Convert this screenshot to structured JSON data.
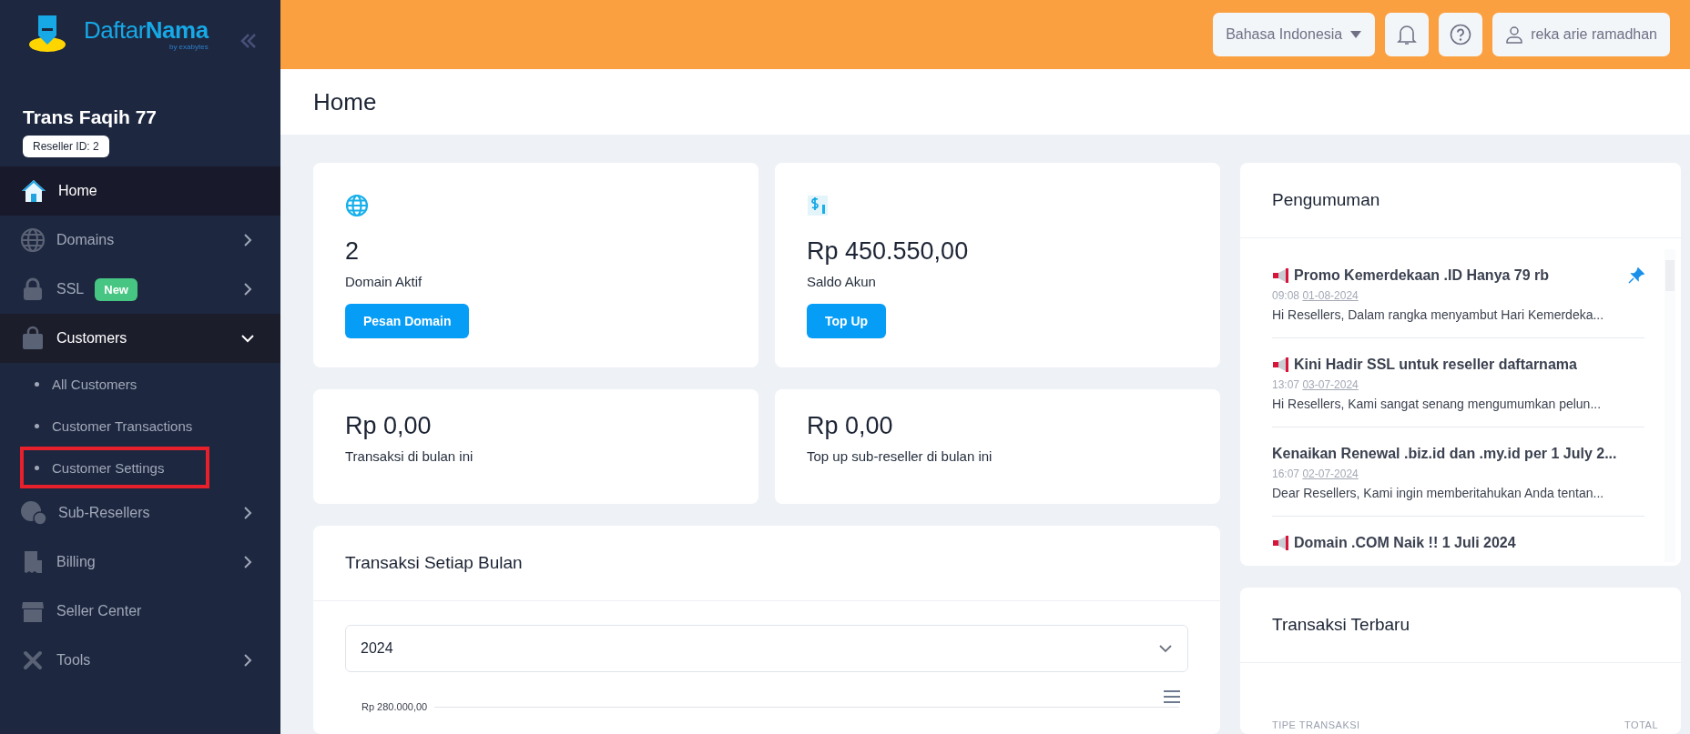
{
  "sidebar": {
    "logo": {
      "word_1": "Daftar",
      "word_2": "Nama",
      "byline": "by exabytes"
    },
    "account_name": "Trans Faqih 77",
    "reseller_id": "Reseller ID: 2",
    "items": [
      {
        "label": "Home",
        "selected": true
      },
      {
        "label": "Domains",
        "selected": false,
        "expanded": false
      },
      {
        "label": "SSL",
        "selected": false,
        "expanded": false,
        "badge": "New"
      },
      {
        "label": "Customers",
        "selected": false,
        "expanded": true,
        "children": [
          {
            "label": "All Customers",
            "selected": false,
            "highlighted": false
          },
          {
            "label": "Customer Transactions",
            "selected": false,
            "highlighted": false
          },
          {
            "label": "Customer Settings",
            "selected": false,
            "highlighted": true
          }
        ]
      },
      {
        "label": "Sub-Resellers",
        "selected": false,
        "expanded": false
      },
      {
        "label": "Billing",
        "selected": false,
        "expanded": false
      },
      {
        "label": "Seller Center",
        "selected": false
      },
      {
        "label": "Tools",
        "selected": false,
        "expanded": false
      }
    ]
  },
  "topbar": {
    "language": "Bahasa Indonesia",
    "user": "reka arie ramadhan"
  },
  "page_title": "Home",
  "stats": [
    {
      "value": "2",
      "label": "Domain Aktif",
      "button": "Pesan Domain"
    },
    {
      "value": "Rp 450.550,00",
      "label": "Saldo Akun",
      "button": "Top Up"
    },
    {
      "value": "Rp 0,00",
      "label": "Transaksi di bulan ini"
    },
    {
      "value": "Rp 0,00",
      "label": "Top up sub-reseller di bulan ini"
    }
  ],
  "chart": {
    "title": "Transaksi Setiap Bulan",
    "year": "2024",
    "y_tick": "Rp 280.000,00"
  },
  "announcements": {
    "title": "Pengumuman",
    "items": [
      {
        "title": "Promo Kemerdekaan .ID Hanya 79 rb",
        "has_icon": true,
        "pinned": true,
        "time": "09:08",
        "date": "01-08-2024",
        "excerpt": "Hi Resellers, Dalam rangka menyambut Hari Kemerdeka..."
      },
      {
        "title": "Kini Hadir SSL untuk reseller daftarnama",
        "has_icon": true,
        "pinned": false,
        "time": "13:07",
        "date": "03-07-2024",
        "excerpt": "Hi Resellers, Kami sangat senang mengumumkan pelun..."
      },
      {
        "title": "Kenaikan Renewal .biz.id dan .my.id per 1 July 2...",
        "has_icon": false,
        "pinned": false,
        "time": "16:07",
        "date": "02-07-2024",
        "excerpt": "Dear Resellers, Kami ingin memberitahukan Anda tentan..."
      },
      {
        "title": "Domain .COM Naik !! 1 Juli 2024",
        "has_icon": true,
        "pinned": false
      }
    ]
  },
  "recent": {
    "title": "Transaksi Terbaru",
    "columns": [
      "TIPE TRANSAKSI",
      "TOTAL"
    ]
  }
}
